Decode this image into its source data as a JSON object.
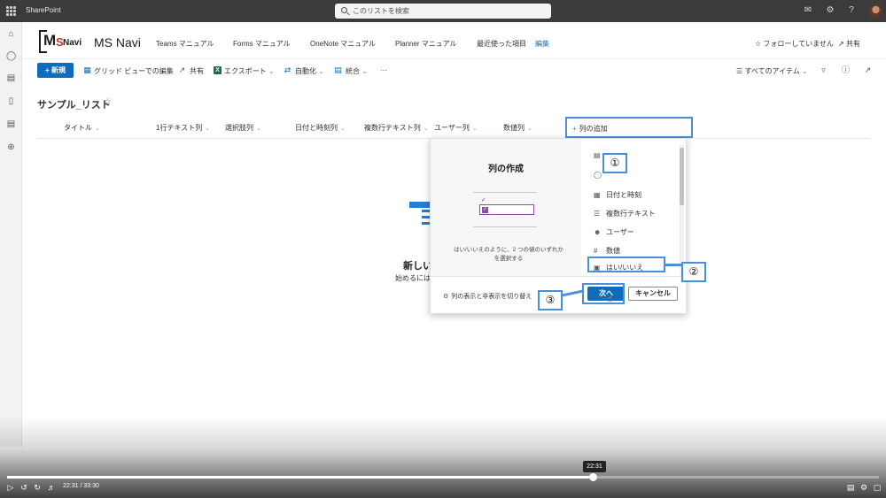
{
  "suitebar": {
    "brand": "SharePoint",
    "search_placeholder": "このリストを検索"
  },
  "site": {
    "logo_m": "M",
    "logo_s": "S",
    "logo_n": "Navi",
    "name": "MS Navi",
    "nav": [
      "Teams マニュアル",
      "Forms マニュアル",
      "OneNote マニュアル",
      "Planner マニュアル",
      "最近使った項目"
    ],
    "edit": "編集",
    "follow": "フォローしていません",
    "share": "共有"
  },
  "commandbar": {
    "new": "新規",
    "grid_edit": "グリッド ビューでの編集",
    "share": "共有",
    "export": "エクスポート",
    "automate": "自動化",
    "integrate": "統合",
    "more": "···",
    "view": "すべてのアイテム"
  },
  "list": {
    "title": "サンプル_リスト",
    "columns": [
      "タイトル",
      "1行テキスト列",
      "選択肢列",
      "日付と時刻列",
      "複数行テキスト列",
      "ユーザー列",
      "数値列"
    ],
    "add_column": "列の追加",
    "empty_title": "新しい",
    "empty_sub": "始めるには"
  },
  "panel": {
    "title": "列の作成",
    "description_1": "はい/いいえのように、2 つの値のいずれか",
    "description_2": "を選択する",
    "items": [
      "日付と時刻",
      "複数行テキスト",
      "ユーザー",
      "数値",
      "はい/いいえ"
    ],
    "toggle": "列の表示と非表示を切り替え",
    "next": "次へ",
    "cancel": "キャンセル"
  },
  "annotations": [
    "①",
    "②",
    "③"
  ],
  "video": {
    "time": "22:31 / 33:30",
    "tooltip": "22:31",
    "progress": 0.672
  },
  "colors": {
    "accent": "#0f6cbd",
    "annotation": "#4a90d9",
    "suitebar": "#3b3b3b"
  }
}
